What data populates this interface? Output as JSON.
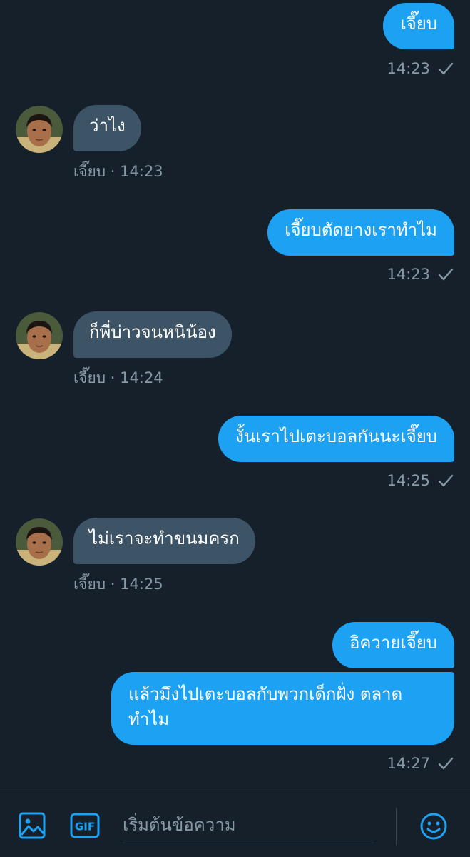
{
  "colors": {
    "background": "#15202b",
    "outgoing_bubble": "#1da1f2",
    "incoming_bubble": "#3d5466",
    "meta_text": "#8899a6",
    "accent": "#1da1f2"
  },
  "messages": [
    {
      "direction": "out",
      "text": "เจี๊ยบ",
      "time": "14:23"
    },
    {
      "direction": "in",
      "sender": "เจี๊ยบ",
      "text": "ว่าไง",
      "meta": "เจี๊ยบ · 14:23"
    },
    {
      "direction": "out",
      "text": "เจี๊ยบตัดยางเราทำไม",
      "time": "14:23"
    },
    {
      "direction": "in",
      "sender": "เจี๊ยบ",
      "text": "ก็พี่บ่าวจนหนิน้อง",
      "meta": "เจี๊ยบ · 14:24"
    },
    {
      "direction": "out",
      "text": "งั้นเราไปเตะบอลกันนะเจี๊ยบ",
      "time": "14:25"
    },
    {
      "direction": "in",
      "sender": "เจี๊ยบ",
      "text": "ไม่เราจะทำขนมครก",
      "meta": "เจี๊ยบ · 14:25"
    },
    {
      "direction": "out",
      "text": "อิควายเจี๊ยบ"
    },
    {
      "direction": "out",
      "text": "แล้วมึงไปเตะบอลกับพวกเด็กฝั่ง ตลาดทำไม",
      "time": "14:27"
    }
  ],
  "composer": {
    "placeholder": "เริ่มต้นข้อความ",
    "media_icon": "image-icon",
    "gif_label": "GIF",
    "emoji_icon": "smiley-icon"
  }
}
